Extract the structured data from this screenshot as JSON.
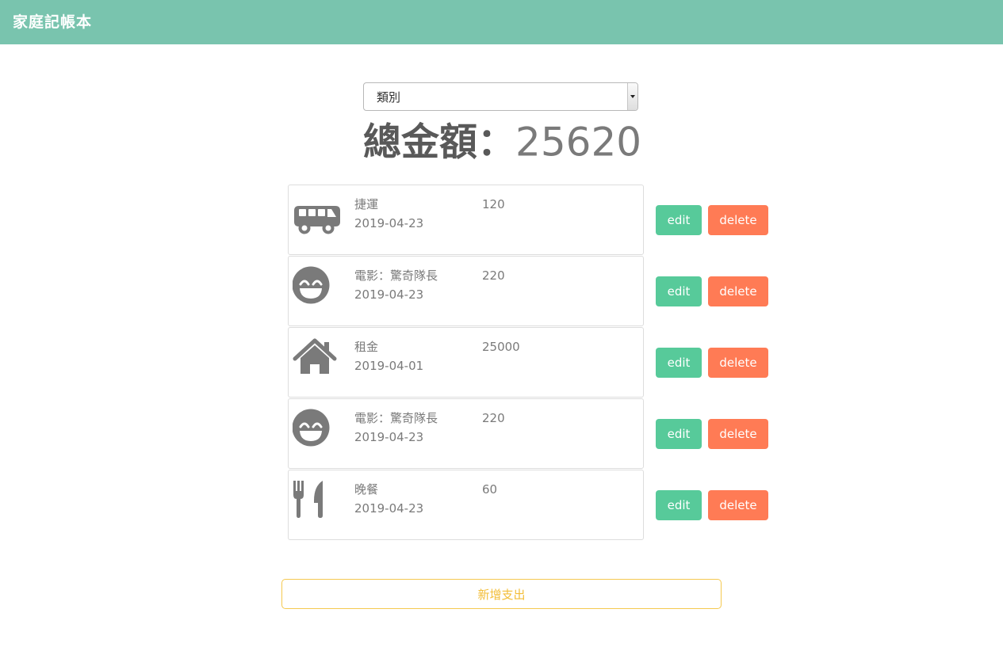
{
  "app": {
    "title": "家庭記帳本"
  },
  "filter": {
    "selected": "類別"
  },
  "summary": {
    "label": "總金額：",
    "value": "25620"
  },
  "records": [
    {
      "icon": "bus-icon",
      "name": "捷運",
      "date": "2019-04-23",
      "amount": "120",
      "edit_label": "edit",
      "delete_label": "delete"
    },
    {
      "icon": "smile-icon",
      "name": "電影：驚奇隊長",
      "date": "2019-04-23",
      "amount": "220",
      "edit_label": "edit",
      "delete_label": "delete"
    },
    {
      "icon": "home-icon",
      "name": "租金",
      "date": "2019-04-01",
      "amount": "25000",
      "edit_label": "edit",
      "delete_label": "delete"
    },
    {
      "icon": "smile-icon",
      "name": "電影：驚奇隊長",
      "date": "2019-04-23",
      "amount": "220",
      "edit_label": "edit",
      "delete_label": "delete"
    },
    {
      "icon": "utensils-icon",
      "name": "晚餐",
      "date": "2019-04-23",
      "amount": "60",
      "edit_label": "edit",
      "delete_label": "delete"
    }
  ],
  "actions": {
    "add_label": "新增支出"
  },
  "colors": {
    "navbar": "#79c4ae",
    "edit": "#57ca9a",
    "delete": "#ff7b55",
    "add_border": "#f5c950",
    "icon": "#7a7a7a"
  }
}
